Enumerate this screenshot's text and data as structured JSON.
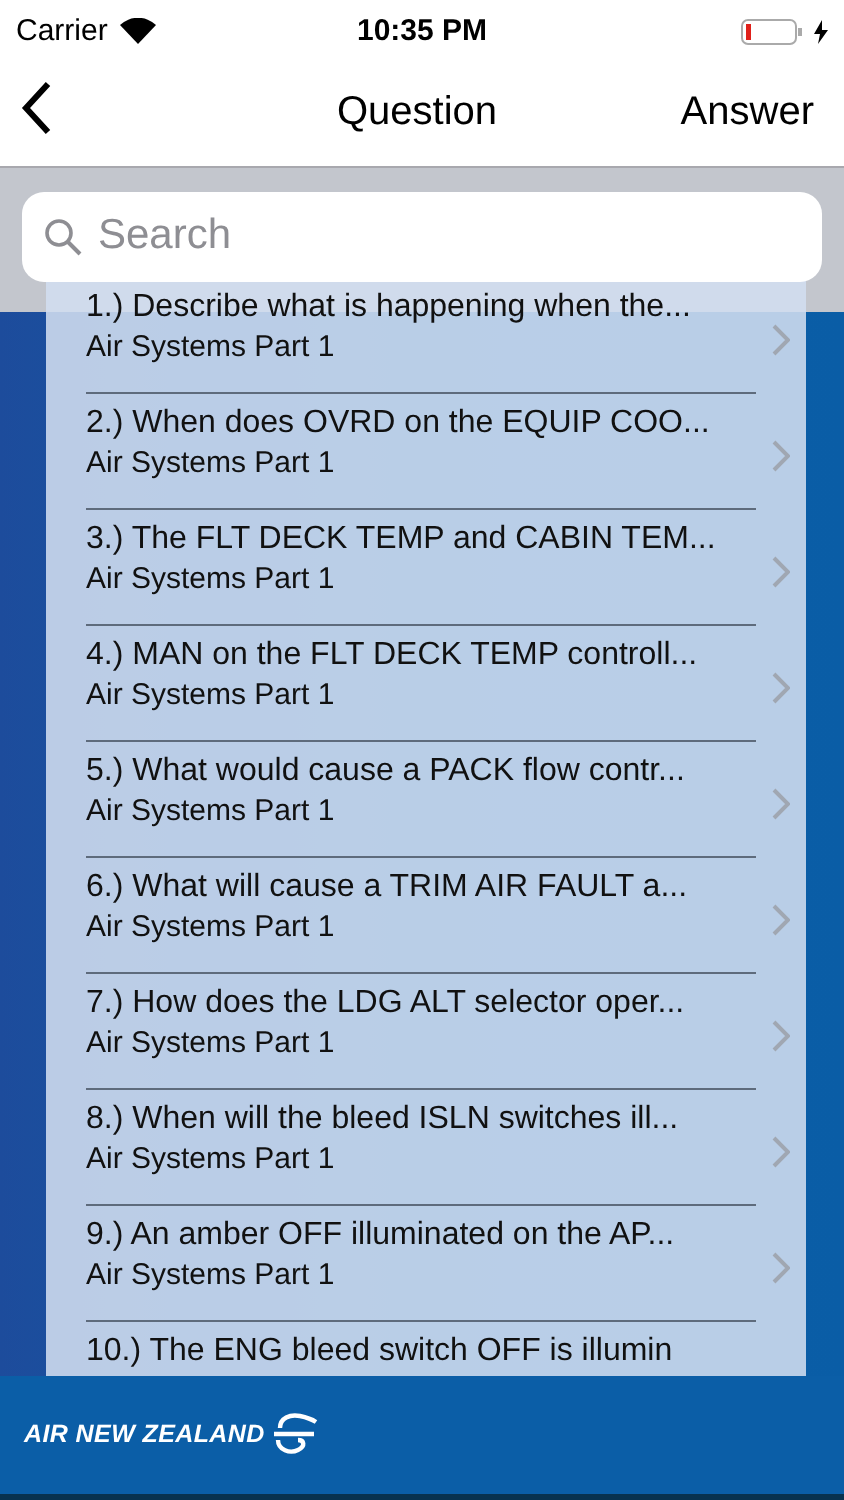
{
  "status_bar": {
    "carrier": "Carrier",
    "time": "10:35 PM"
  },
  "nav_bar": {
    "title": "Question",
    "action": "Answer"
  },
  "search": {
    "placeholder": "Search"
  },
  "questions": [
    {
      "title": "1.) Describe what is happening when the...",
      "subtitle": "Air Systems Part 1"
    },
    {
      "title": "2.) When does OVRD on the EQUIP COO...",
      "subtitle": "Air Systems Part 1"
    },
    {
      "title": "3.) The FLT DECK TEMP and CABIN TEM...",
      "subtitle": "Air Systems Part 1"
    },
    {
      "title": "4.) MAN on the FLT DECK TEMP controll...",
      "subtitle": "Air Systems Part 1"
    },
    {
      "title": "5.) What would cause a PACK flow contr...",
      "subtitle": "Air Systems Part 1"
    },
    {
      "title": "6.) What will cause a TRIM AIR FAULT a...",
      "subtitle": "Air Systems Part 1"
    },
    {
      "title": "7.) How does the LDG ALT selector oper...",
      "subtitle": "Air Systems Part 1"
    },
    {
      "title": "8.) When will the bleed ISLN switches ill...",
      "subtitle": "Air Systems Part 1"
    },
    {
      "title": "9.) An amber OFF illuminated on the AP...",
      "subtitle": "Air Systems Part 1"
    },
    {
      "title": "10.) The ENG bleed switch OFF is illumin"
    }
  ],
  "footer": {
    "brand": "AIR NEW ZEALAND"
  }
}
